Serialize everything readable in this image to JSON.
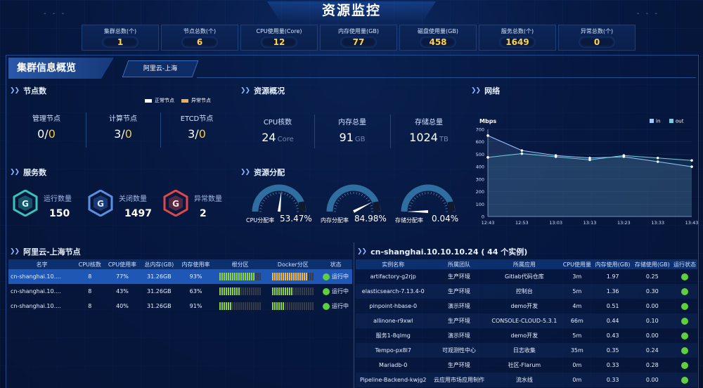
{
  "header": {
    "title": "资源监控",
    "deco": "- - -"
  },
  "stats": [
    {
      "label": "集群总数(个)",
      "value": "1"
    },
    {
      "label": "节点总数(个)",
      "value": "6"
    },
    {
      "label": "CPU使用量(Core)",
      "value": "12"
    },
    {
      "label": "内存使用量(GB)",
      "value": "77"
    },
    {
      "label": "磁盘使用量(GB)",
      "value": "458"
    },
    {
      "label": "服务总数(个)",
      "value": "1649"
    },
    {
      "label": "异常总数(个)",
      "value": "0"
    }
  ],
  "panel": {
    "title": "集群信息概览",
    "tab": "阿里云-上海"
  },
  "nodes": {
    "title": "节点数",
    "legend_normal": "正常节点",
    "legend_abnormal": "异常节点",
    "items": [
      {
        "label": "管理节点",
        "normal": "0",
        "abnormal": "0"
      },
      {
        "label": "计算节点",
        "normal": "3",
        "abnormal": "0"
      },
      {
        "label": "ETCD节点",
        "normal": "3",
        "abnormal": "0"
      }
    ]
  },
  "resources": {
    "title": "资源概况",
    "items": [
      {
        "label": "CPU核数",
        "value": "24",
        "unit": "Core"
      },
      {
        "label": "内存总量",
        "value": "91",
        "unit": "GB"
      },
      {
        "label": "存储总量",
        "value": "1024",
        "unit": "TB"
      }
    ]
  },
  "network": {
    "title": "网络"
  },
  "services": {
    "title": "服务数",
    "items": [
      {
        "label": "运行数量",
        "value": "150",
        "color": "#38c4b8"
      },
      {
        "label": "关闭数量",
        "value": "1497",
        "color": "#3c78d8"
      },
      {
        "label": "异常数量",
        "value": "2",
        "color": "#e04848"
      }
    ]
  },
  "allocation": {
    "title": "资源分配",
    "items": [
      {
        "label": "CPU分配率",
        "value": "53.47%",
        "pct": 53.47
      },
      {
        "label": "内存分配率",
        "value": "84.98%",
        "pct": 84.98
      },
      {
        "label": "存储分配率",
        "value": "0.04%",
        "pct": 0.04
      }
    ]
  },
  "nodes_table": {
    "title": "阿里云-上海节点",
    "headers": [
      "名字",
      "CPU核数",
      "CPU使用率",
      "总内存(GB)",
      "内存使用率",
      "根分区",
      "Docker分区",
      "状态"
    ],
    "rows": [
      {
        "name": "cn-shanghai.10....",
        "cores": "8",
        "cpu": "77%",
        "mem": "31.26GB",
        "memuse": "93%",
        "root": 0.85,
        "docker": 0.85,
        "status": "运行中"
      },
      {
        "name": "cn-shanghai.10....",
        "cores": "8",
        "cpu": "43%",
        "mem": "31.26GB",
        "memuse": "63%",
        "root": 0.5,
        "docker": 0.5,
        "status": "运行中"
      },
      {
        "name": "cn-shanghai.10....",
        "cores": "8",
        "cpu": "40%",
        "mem": "31.26GB",
        "memuse": "91%",
        "root": 0.3,
        "docker": 0.3,
        "status": "运行中"
      }
    ]
  },
  "instances_table": {
    "title": "cn-shanghai.10.10.10.24 ( 44 个实例)",
    "headers": [
      "实例名称",
      "所属团队",
      "所属应用",
      "CPU使用量",
      "内存使用(GB)",
      "存储使用(GB)",
      "运行状态"
    ],
    "rows": [
      [
        "artifactory-g2rjp",
        "生产环境",
        "Gitlab代码仓库",
        "3m",
        "1.97",
        "0.25"
      ],
      [
        "elasticsearch-7.13.4-0",
        "生产环境",
        "控制台",
        "5m",
        "1.36",
        "0.30"
      ],
      [
        "pinpoint-hbase-0",
        "演示环境",
        "demo开发",
        "4m",
        "0.51",
        "0.00"
      ],
      [
        "allinone-r9xwl",
        "生产环境",
        "CONSOLE-CLOUD-5.3.1",
        "66m",
        "0.44",
        "0.10"
      ],
      [
        "服务1-8qlmg",
        "演示环境",
        "demo开发",
        "5m",
        "0.43",
        "0.00"
      ],
      [
        "Tempo-px8l7",
        "可观测性中心",
        "日志收集",
        "35m",
        "0.35",
        "0.24"
      ],
      [
        "Mariadb-0",
        "生产环境",
        "社区-Flarum",
        "0m",
        "0.33",
        "0.28"
      ],
      [
        "Pipeline-Backend-kwjg2",
        "云应用市场应用制作",
        "流水线",
        "0m",
        "0.33",
        "0.00"
      ]
    ]
  },
  "chart_data": {
    "type": "line",
    "ylabel": "Mbps",
    "x": [
      "12:43",
      "12:53",
      "13:03",
      "13:13",
      "13:23",
      "13:33",
      "13:43"
    ],
    "ylim": [
      0,
      700
    ],
    "yticks": [
      0,
      100,
      200,
      300,
      400,
      500,
      600,
      700
    ],
    "series": [
      {
        "name": "in",
        "color": "#9ec8ff",
        "values": [
          650,
          530,
          490,
          470,
          480,
          440,
          400
        ]
      },
      {
        "name": "out",
        "color": "#6fd0e0",
        "values": [
          475,
          505,
          480,
          455,
          490,
          470,
          450
        ]
      }
    ]
  }
}
